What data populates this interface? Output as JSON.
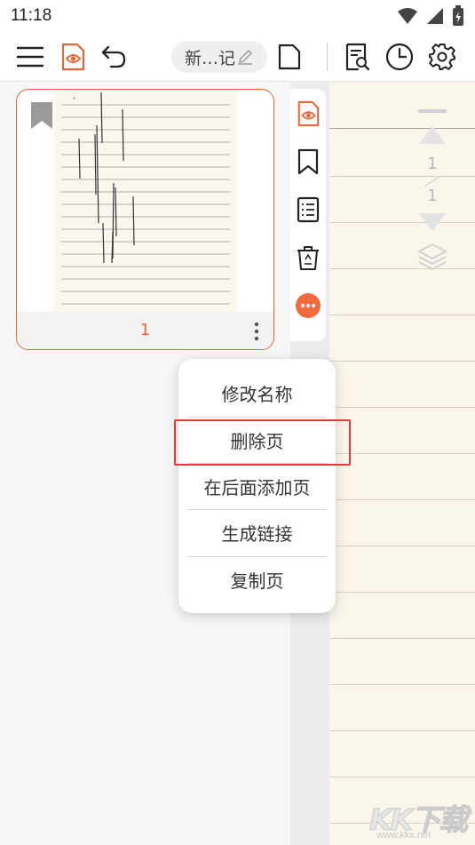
{
  "status_bar": {
    "time": "11:18"
  },
  "toolbar": {
    "title": "新…记",
    "icons": [
      "menu-icon",
      "eye-page-icon",
      "undo-icon",
      "edit-pencil-icon",
      "new-page-icon",
      "search-notes-icon",
      "history-clock-icon",
      "settings-gear-icon"
    ]
  },
  "page_card": {
    "page_number": "1",
    "bookmarked": true
  },
  "side_tools": [
    "eye-page-icon",
    "bookmark-icon",
    "outline-list-icon",
    "recycle-bin-icon",
    "more-icon"
  ],
  "page_nav": {
    "current": "1",
    "total": "1"
  },
  "context_menu": {
    "items": [
      {
        "label": "修改名称"
      },
      {
        "label": "删除页"
      },
      {
        "label": "在后面添加页"
      },
      {
        "label": "生成链接"
      },
      {
        "label": "复制页"
      }
    ],
    "highlighted_item": "删除页"
  },
  "watermark": {
    "brand": "KK下载",
    "url": "www.kkx.net"
  },
  "colors": {
    "accent": "#e8643a",
    "highlight_box": "#e33a3a",
    "paper": "#fbf6ec"
  }
}
